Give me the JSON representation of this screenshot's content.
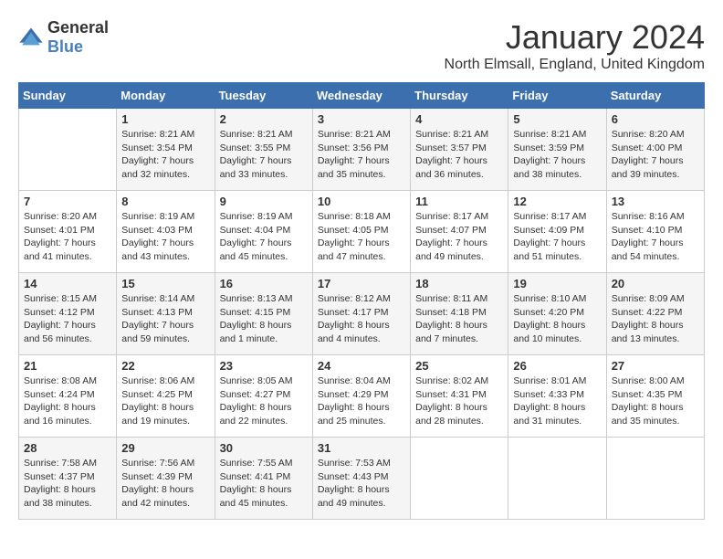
{
  "logo": {
    "general": "General",
    "blue": "Blue"
  },
  "title": "January 2024",
  "location": "North Elmsall, England, United Kingdom",
  "days_of_week": [
    "Sunday",
    "Monday",
    "Tuesday",
    "Wednesday",
    "Thursday",
    "Friday",
    "Saturday"
  ],
  "weeks": [
    [
      {
        "day": "",
        "sunrise": "",
        "sunset": "",
        "daylight": ""
      },
      {
        "day": "1",
        "sunrise": "Sunrise: 8:21 AM",
        "sunset": "Sunset: 3:54 PM",
        "daylight": "Daylight: 7 hours and 32 minutes."
      },
      {
        "day": "2",
        "sunrise": "Sunrise: 8:21 AM",
        "sunset": "Sunset: 3:55 PM",
        "daylight": "Daylight: 7 hours and 33 minutes."
      },
      {
        "day": "3",
        "sunrise": "Sunrise: 8:21 AM",
        "sunset": "Sunset: 3:56 PM",
        "daylight": "Daylight: 7 hours and 35 minutes."
      },
      {
        "day": "4",
        "sunrise": "Sunrise: 8:21 AM",
        "sunset": "Sunset: 3:57 PM",
        "daylight": "Daylight: 7 hours and 36 minutes."
      },
      {
        "day": "5",
        "sunrise": "Sunrise: 8:21 AM",
        "sunset": "Sunset: 3:59 PM",
        "daylight": "Daylight: 7 hours and 38 minutes."
      },
      {
        "day": "6",
        "sunrise": "Sunrise: 8:20 AM",
        "sunset": "Sunset: 4:00 PM",
        "daylight": "Daylight: 7 hours and 39 minutes."
      }
    ],
    [
      {
        "day": "7",
        "sunrise": "Sunrise: 8:20 AM",
        "sunset": "Sunset: 4:01 PM",
        "daylight": "Daylight: 7 hours and 41 minutes."
      },
      {
        "day": "8",
        "sunrise": "Sunrise: 8:19 AM",
        "sunset": "Sunset: 4:03 PM",
        "daylight": "Daylight: 7 hours and 43 minutes."
      },
      {
        "day": "9",
        "sunrise": "Sunrise: 8:19 AM",
        "sunset": "Sunset: 4:04 PM",
        "daylight": "Daylight: 7 hours and 45 minutes."
      },
      {
        "day": "10",
        "sunrise": "Sunrise: 8:18 AM",
        "sunset": "Sunset: 4:05 PM",
        "daylight": "Daylight: 7 hours and 47 minutes."
      },
      {
        "day": "11",
        "sunrise": "Sunrise: 8:17 AM",
        "sunset": "Sunset: 4:07 PM",
        "daylight": "Daylight: 7 hours and 49 minutes."
      },
      {
        "day": "12",
        "sunrise": "Sunrise: 8:17 AM",
        "sunset": "Sunset: 4:09 PM",
        "daylight": "Daylight: 7 hours and 51 minutes."
      },
      {
        "day": "13",
        "sunrise": "Sunrise: 8:16 AM",
        "sunset": "Sunset: 4:10 PM",
        "daylight": "Daylight: 7 hours and 54 minutes."
      }
    ],
    [
      {
        "day": "14",
        "sunrise": "Sunrise: 8:15 AM",
        "sunset": "Sunset: 4:12 PM",
        "daylight": "Daylight: 7 hours and 56 minutes."
      },
      {
        "day": "15",
        "sunrise": "Sunrise: 8:14 AM",
        "sunset": "Sunset: 4:13 PM",
        "daylight": "Daylight: 7 hours and 59 minutes."
      },
      {
        "day": "16",
        "sunrise": "Sunrise: 8:13 AM",
        "sunset": "Sunset: 4:15 PM",
        "daylight": "Daylight: 8 hours and 1 minute."
      },
      {
        "day": "17",
        "sunrise": "Sunrise: 8:12 AM",
        "sunset": "Sunset: 4:17 PM",
        "daylight": "Daylight: 8 hours and 4 minutes."
      },
      {
        "day": "18",
        "sunrise": "Sunrise: 8:11 AM",
        "sunset": "Sunset: 4:18 PM",
        "daylight": "Daylight: 8 hours and 7 minutes."
      },
      {
        "day": "19",
        "sunrise": "Sunrise: 8:10 AM",
        "sunset": "Sunset: 4:20 PM",
        "daylight": "Daylight: 8 hours and 10 minutes."
      },
      {
        "day": "20",
        "sunrise": "Sunrise: 8:09 AM",
        "sunset": "Sunset: 4:22 PM",
        "daylight": "Daylight: 8 hours and 13 minutes."
      }
    ],
    [
      {
        "day": "21",
        "sunrise": "Sunrise: 8:08 AM",
        "sunset": "Sunset: 4:24 PM",
        "daylight": "Daylight: 8 hours and 16 minutes."
      },
      {
        "day": "22",
        "sunrise": "Sunrise: 8:06 AM",
        "sunset": "Sunset: 4:25 PM",
        "daylight": "Daylight: 8 hours and 19 minutes."
      },
      {
        "day": "23",
        "sunrise": "Sunrise: 8:05 AM",
        "sunset": "Sunset: 4:27 PM",
        "daylight": "Daylight: 8 hours and 22 minutes."
      },
      {
        "day": "24",
        "sunrise": "Sunrise: 8:04 AM",
        "sunset": "Sunset: 4:29 PM",
        "daylight": "Daylight: 8 hours and 25 minutes."
      },
      {
        "day": "25",
        "sunrise": "Sunrise: 8:02 AM",
        "sunset": "Sunset: 4:31 PM",
        "daylight": "Daylight: 8 hours and 28 minutes."
      },
      {
        "day": "26",
        "sunrise": "Sunrise: 8:01 AM",
        "sunset": "Sunset: 4:33 PM",
        "daylight": "Daylight: 8 hours and 31 minutes."
      },
      {
        "day": "27",
        "sunrise": "Sunrise: 8:00 AM",
        "sunset": "Sunset: 4:35 PM",
        "daylight": "Daylight: 8 hours and 35 minutes."
      }
    ],
    [
      {
        "day": "28",
        "sunrise": "Sunrise: 7:58 AM",
        "sunset": "Sunset: 4:37 PM",
        "daylight": "Daylight: 8 hours and 38 minutes."
      },
      {
        "day": "29",
        "sunrise": "Sunrise: 7:56 AM",
        "sunset": "Sunset: 4:39 PM",
        "daylight": "Daylight: 8 hours and 42 minutes."
      },
      {
        "day": "30",
        "sunrise": "Sunrise: 7:55 AM",
        "sunset": "Sunset: 4:41 PM",
        "daylight": "Daylight: 8 hours and 45 minutes."
      },
      {
        "day": "31",
        "sunrise": "Sunrise: 7:53 AM",
        "sunset": "Sunset: 4:43 PM",
        "daylight": "Daylight: 8 hours and 49 minutes."
      },
      {
        "day": "",
        "sunrise": "",
        "sunset": "",
        "daylight": ""
      },
      {
        "day": "",
        "sunrise": "",
        "sunset": "",
        "daylight": ""
      },
      {
        "day": "",
        "sunrise": "",
        "sunset": "",
        "daylight": ""
      }
    ]
  ]
}
